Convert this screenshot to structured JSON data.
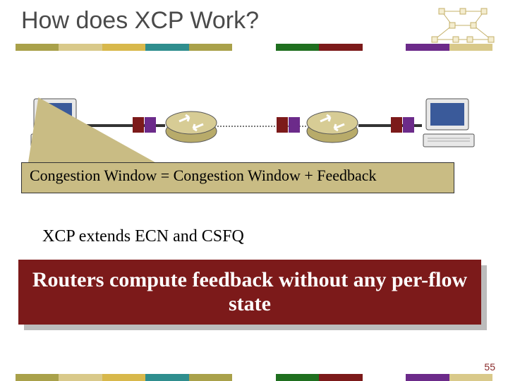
{
  "title": "How does XCP Work?",
  "callout_equation": "Congestion Window = Congestion Window + Feedback",
  "extends_line": "XCP extends ECN and CSFQ",
  "highlight_box": "Routers compute feedback without any per-flow state",
  "page_number": "55",
  "topology": {
    "left_node": "pc",
    "router_a": "router",
    "router_b": "router",
    "right_node": "pc"
  },
  "colors": {
    "maroon": "#7c1a1a",
    "olive": "#a9a14a",
    "tan": "#d9c98a",
    "gold": "#d8b84b",
    "teal": "#2f8e8e",
    "green": "#1f6f1f",
    "purple": "#6c2b8a"
  }
}
